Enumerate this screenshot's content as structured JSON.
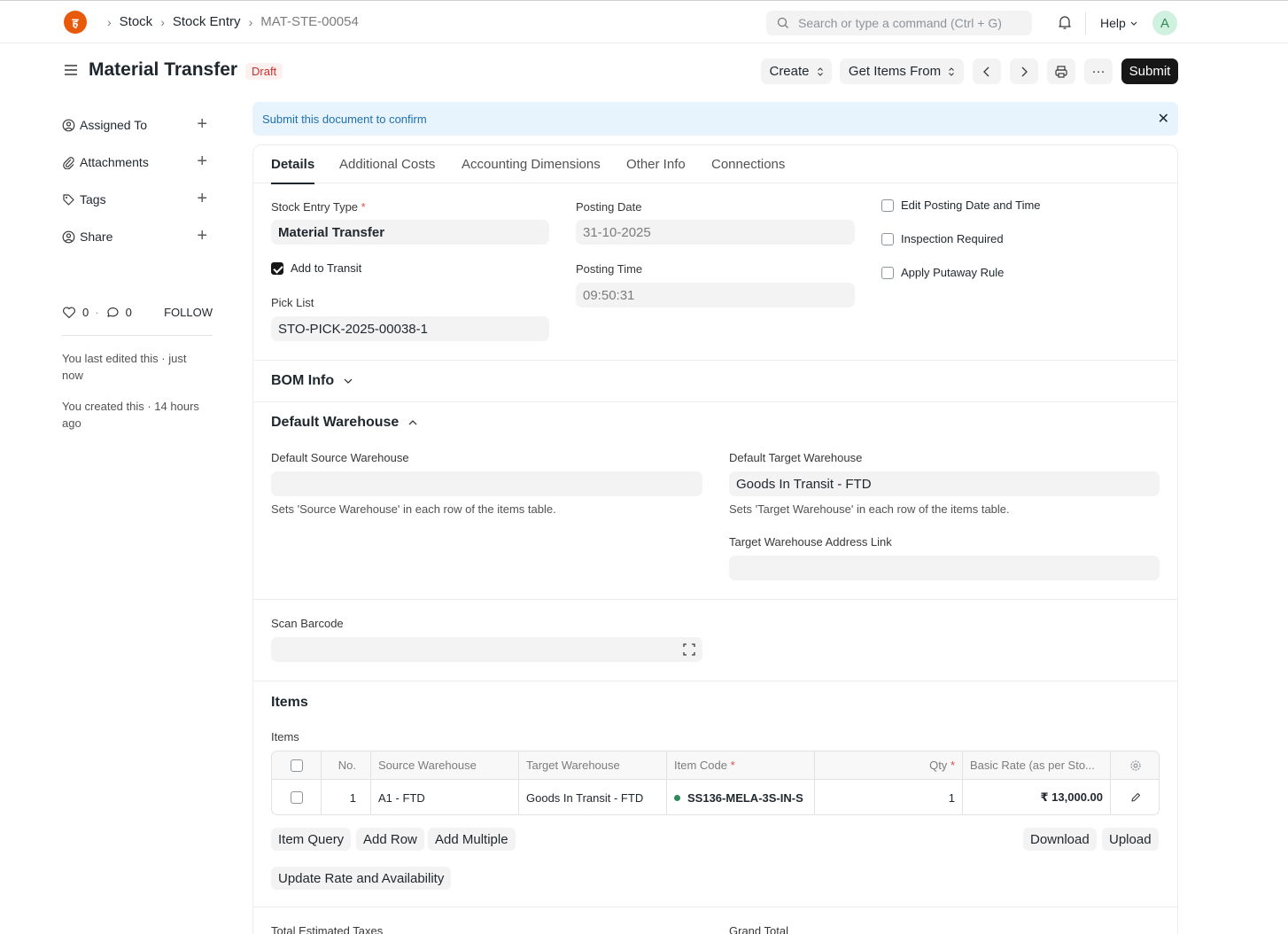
{
  "navbar": {
    "logo_text": "ह",
    "breadcrumbs": [
      "Stock",
      "Stock Entry",
      "MAT-STE-00054"
    ],
    "search_placeholder": "Search or type a command (Ctrl + G)",
    "help_label": "Help",
    "avatar_initial": "A"
  },
  "page": {
    "title": "Material Transfer",
    "status": "Draft",
    "actions": {
      "create": "Create",
      "get_items_from": "Get Items From",
      "more": "···",
      "submit": "Submit"
    }
  },
  "sidebar": {
    "items": [
      {
        "label": "Assigned To",
        "icon": "assign-icon"
      },
      {
        "label": "Attachments",
        "icon": "paperclip-icon"
      },
      {
        "label": "Tags",
        "icon": "tag-icon"
      },
      {
        "label": "Share",
        "icon": "share-icon"
      }
    ],
    "likes": "0",
    "comments": "0",
    "follow": "FOLLOW",
    "last_edited": "You last edited this · just now",
    "created": "You created this · 14 hours ago"
  },
  "alert": {
    "text": "Submit this document to confirm"
  },
  "tabs": [
    "Details",
    "Additional Costs",
    "Accounting Dimensions",
    "Other Info",
    "Connections"
  ],
  "details": {
    "stock_entry_type_label": "Stock Entry Type",
    "stock_entry_type_value": "Material Transfer",
    "add_to_transit_label": "Add to Transit",
    "add_to_transit_checked": true,
    "pick_list_label": "Pick List",
    "pick_list_value": "STO-PICK-2025-00038-1",
    "posting_date_label": "Posting Date",
    "posting_date_value": "31-10-2025",
    "posting_time_label": "Posting Time",
    "posting_time_value": "09:50:31",
    "edit_posting_label": "Edit Posting Date and Time",
    "inspection_label": "Inspection Required",
    "putaway_label": "Apply Putaway Rule"
  },
  "bom_section": {
    "title": "BOM Info"
  },
  "warehouse_section": {
    "title": "Default Warehouse",
    "source_label": "Default Source Warehouse",
    "source_value": "",
    "source_desc": "Sets 'Source Warehouse' in each row of the items table.",
    "target_label": "Default Target Warehouse",
    "target_value": "Goods In Transit - FTD",
    "target_desc": "Sets 'Target Warehouse' in each row of the items table.",
    "address_label": "Target Warehouse Address Link",
    "address_value": ""
  },
  "barcode": {
    "label": "Scan Barcode"
  },
  "items_section": {
    "title": "Items",
    "table_label": "Items",
    "columns": [
      "No.",
      "Source Warehouse",
      "Target Warehouse",
      "Item Code",
      "Qty",
      "Basic Rate (as per Sto..."
    ],
    "rows": [
      {
        "no": "1",
        "source_warehouse": "A1 - FTD",
        "target_warehouse": "Goods In Transit - FTD",
        "item_code": "SS136-MELA-3S-IN-S",
        "qty": "1",
        "basic_rate": "₹ 13,000.00"
      }
    ],
    "buttons": {
      "item_query": "Item Query",
      "add_row": "Add Row",
      "add_multiple": "Add Multiple",
      "download": "Download",
      "upload": "Upload",
      "update_rate": "Update Rate and Availability"
    }
  },
  "totals": {
    "taxes_label": "Total Estimated Taxes",
    "grand_total_label": "Grand Total"
  }
}
